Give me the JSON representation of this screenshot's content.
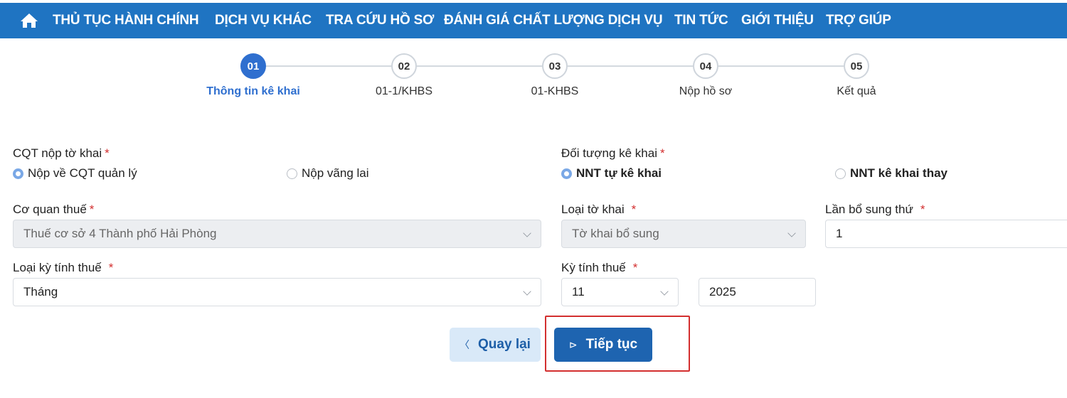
{
  "nav": {
    "items": [
      "THỦ TỤC HÀNH CHÍNH",
      "DỊCH VỤ KHÁC",
      "TRA CỨU HỒ SƠ",
      "ĐÁNH GIÁ CHẤT LƯỢNG DỊCH VỤ",
      "TIN TỨC",
      "GIỚI THIỆU",
      "TRỢ GIÚP"
    ]
  },
  "steps": [
    {
      "number": "01",
      "label": "Thông tin kê khai",
      "active": true
    },
    {
      "number": "02",
      "label": "01-1/KHBS",
      "active": false
    },
    {
      "number": "03",
      "label": "01-KHBS",
      "active": false
    },
    {
      "number": "04",
      "label": "Nộp hồ sơ",
      "active": false
    },
    {
      "number": "05",
      "label": "Kết quả",
      "active": false
    }
  ],
  "form": {
    "required_mark": "*",
    "cqt_nop": {
      "label": "CQT nộp tờ khai",
      "options": [
        "Nộp về CQT quản lý",
        "Nộp vãng lai"
      ],
      "selected": "Nộp về CQT quản lý"
    },
    "doi_tuong": {
      "label": "Đối tượng kê khai",
      "options": [
        "NNT tự kê khai",
        "NNT kê khai thay"
      ],
      "selected": "NNT tự kê khai"
    },
    "co_quan_thue": {
      "label": "Cơ quan thuế",
      "value": "Thuế cơ sở 4 Thành phố Hải Phòng"
    },
    "loai_to_khai": {
      "label": "Loại tờ khai",
      "value": "Tờ khai bổ sung"
    },
    "lan_bo_sung": {
      "label": "Lần bổ sung thứ",
      "value": "1"
    },
    "loai_ky": {
      "label": "Loại kỳ tính thuế",
      "value": "Tháng"
    },
    "ky_tinh_thue": {
      "label": "Kỳ tính thuế",
      "month": "11",
      "year": "2025"
    }
  },
  "buttons": {
    "back": {
      "icon": "chevron-left-icon",
      "glyph": "〈",
      "label": "Quay lại"
    },
    "next": {
      "icon": "play-icon",
      "glyph": "⊳",
      "label": "Tiếp tục"
    }
  },
  "colors": {
    "nav": "#1f74c2",
    "accent": "#2f6fcf",
    "highlight": "#d32f2f"
  }
}
